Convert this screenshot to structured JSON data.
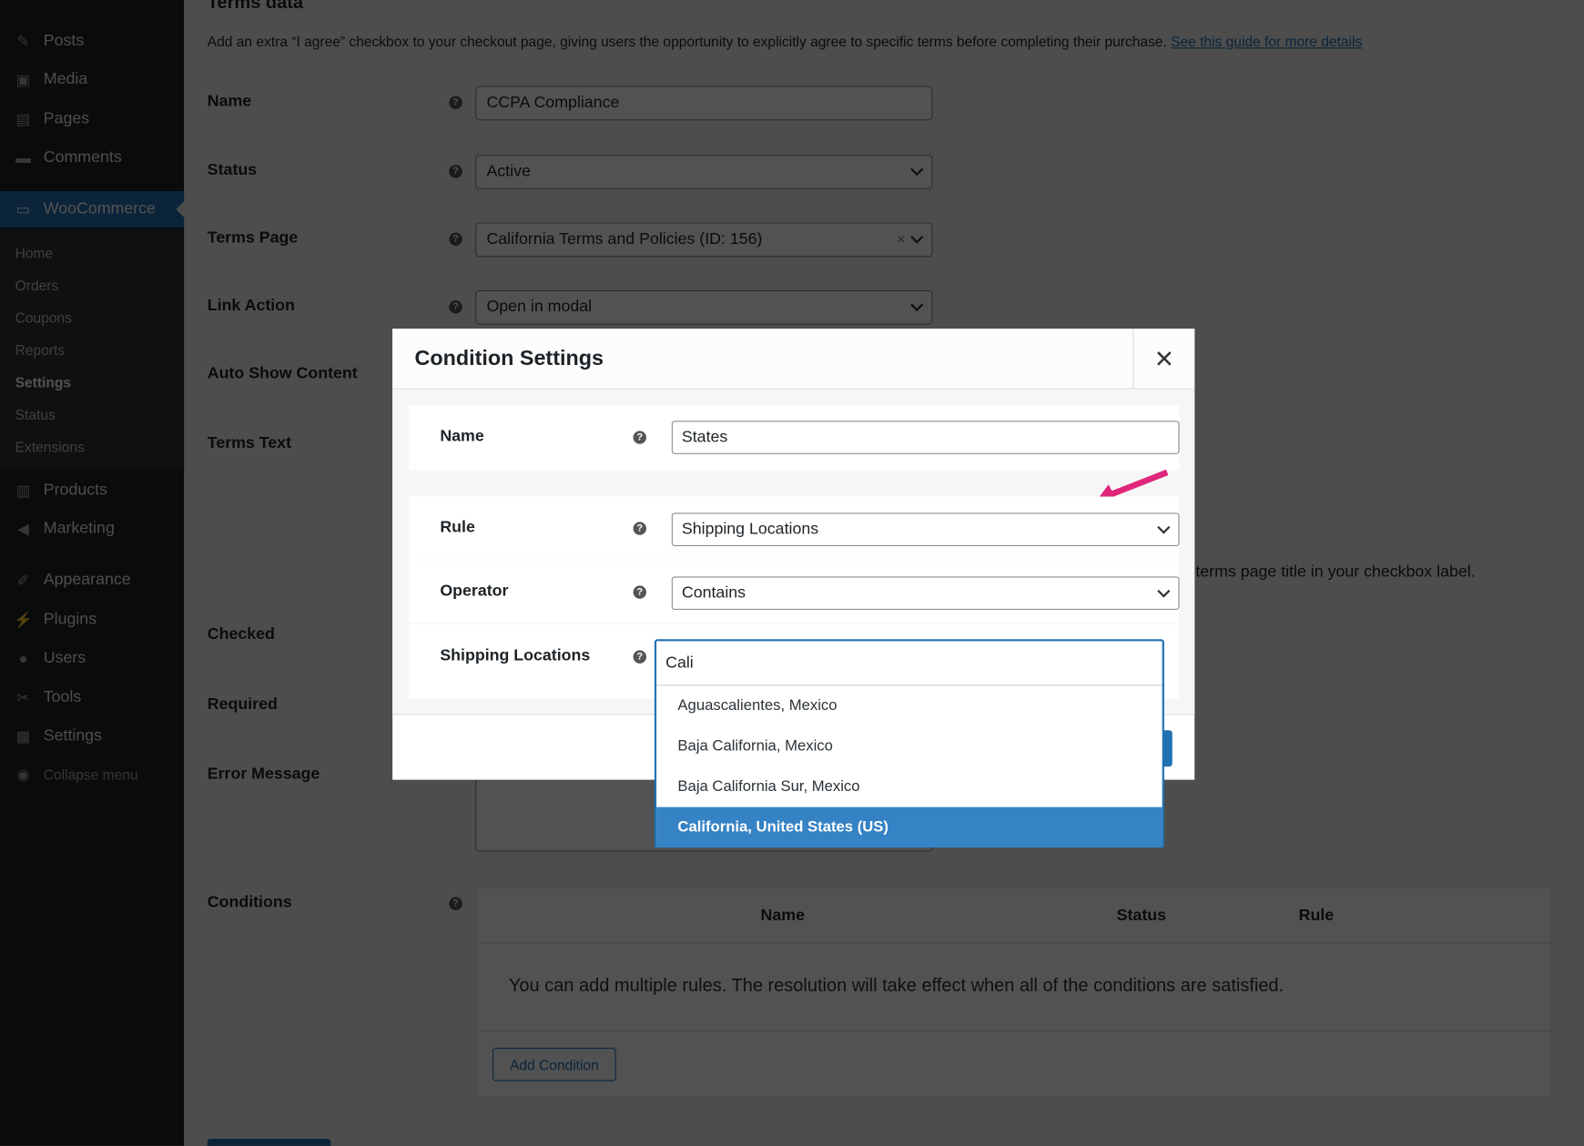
{
  "sidebar": {
    "items": [
      {
        "label": "Posts",
        "icon": "pin-icon"
      },
      {
        "label": "Media",
        "icon": "media-icon"
      },
      {
        "label": "Pages",
        "icon": "pages-icon"
      },
      {
        "label": "Comments",
        "icon": "comment-icon"
      },
      {
        "label": "WooCommerce",
        "icon": "woo-icon"
      },
      {
        "label": "Products",
        "icon": "products-icon"
      },
      {
        "label": "Marketing",
        "icon": "megaphone-icon"
      },
      {
        "label": "Appearance",
        "icon": "brush-icon"
      },
      {
        "label": "Plugins",
        "icon": "plug-icon"
      },
      {
        "label": "Users",
        "icon": "user-icon"
      },
      {
        "label": "Tools",
        "icon": "wrench-icon"
      },
      {
        "label": "Settings",
        "icon": "settings-icon"
      },
      {
        "label": "Collapse menu",
        "icon": "collapse-icon"
      }
    ],
    "submenu": [
      "Home",
      "Orders",
      "Coupons",
      "Reports",
      "Settings",
      "Status",
      "Extensions"
    ]
  },
  "page": {
    "heading": "Terms data",
    "description": "Add an extra “I agree” checkbox to your checkout page, giving users the opportunity to explicitly agree to specific terms before completing their purchase.",
    "guide_link": "See this guide for more details",
    "labels": {
      "name": "Name",
      "status": "Status",
      "terms_page": "Terms Page",
      "link_action": "Link Action",
      "auto_show": "Auto Show Content",
      "terms_text": "Terms Text",
      "checked": "Checked",
      "required": "Required",
      "error": "Error Message",
      "conditions": "Conditions"
    },
    "values": {
      "name": "CCPA Compliance",
      "status": "Active",
      "terms_page": "California Terms and Policies (ID: 156)",
      "link_action": "Open in modal"
    },
    "terms_hint": "terms page title in your checkbox label.",
    "conditions_table": {
      "headers": [
        "Name",
        "Status",
        "Rule"
      ],
      "empty": "You can add multiple rules. The resolution will take effect when all of the conditions are satisfied.",
      "add_button": "Add Condition"
    }
  },
  "modal": {
    "title": "Condition Settings",
    "labels": {
      "name": "Name",
      "rule": "Rule",
      "operator": "Operator",
      "locations": "Shipping Locations"
    },
    "values": {
      "name": "States",
      "rule": "Shipping Locations",
      "operator": "Contains",
      "search": "Cali"
    },
    "options": [
      "Aguascalientes, Mexico",
      "Baja California, Mexico",
      "Baja California Sur, Mexico",
      "California, United States (US)"
    ],
    "highlighted_option": "California, United States (US)",
    "arrow_color": "#e0267a",
    "accent": "#2271b1"
  }
}
